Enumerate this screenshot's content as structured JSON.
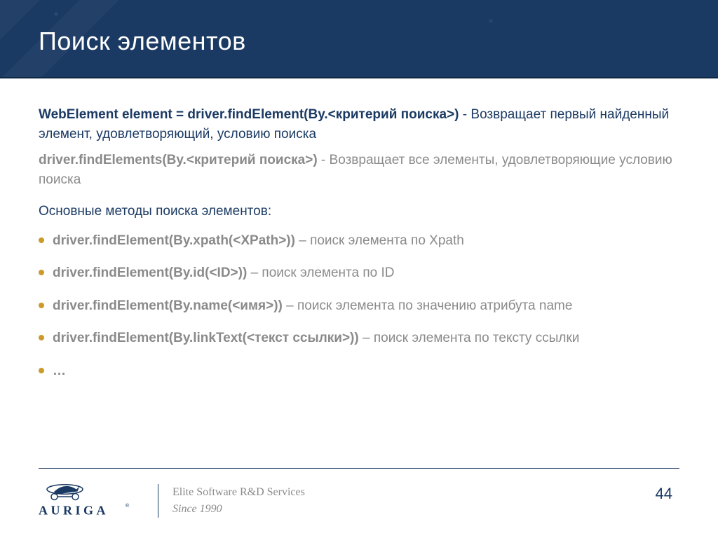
{
  "title": "Поиск элементов",
  "para1": {
    "bold": "WebElement element = driver.findElement(By.<критерий поиска>)",
    "rest": " - Возвращает первый найденный элемент, удовлетворяющий, условию поиска"
  },
  "para2": {
    "bold": "driver.findElements(By.<критерий поиска>)",
    "rest": " - Возвращает все элементы, удовлетворяющие условию поиска"
  },
  "section": "Основные методы поиска элементов:",
  "items": [
    {
      "bold": "driver.findElement(By.xpath(<XPath>))",
      "rest": " – поиск элемента по Xpath"
    },
    {
      "bold": "driver.findElement(By.id(<ID>))",
      "rest": " – поиск элемента по ID"
    },
    {
      "bold": "driver.findElement(By.name(<имя>))",
      "rest": " – поиск элемента по значению атрибута name"
    },
    {
      "bold": "driver.findElement(By.linkText(<текст ссылки>))",
      "rest": " – поиск элемента по тексту ссылки"
    },
    {
      "bold": "…",
      "rest": ""
    }
  ],
  "footer": {
    "brand": "AURIGA",
    "tagline1": "Elite Software R&D Services",
    "tagline2": "Since 1990",
    "page": "44"
  },
  "colors": {
    "brand_blue": "#1b3a63",
    "bullet": "#cc9a2b",
    "muted": "#8a8a8a"
  }
}
